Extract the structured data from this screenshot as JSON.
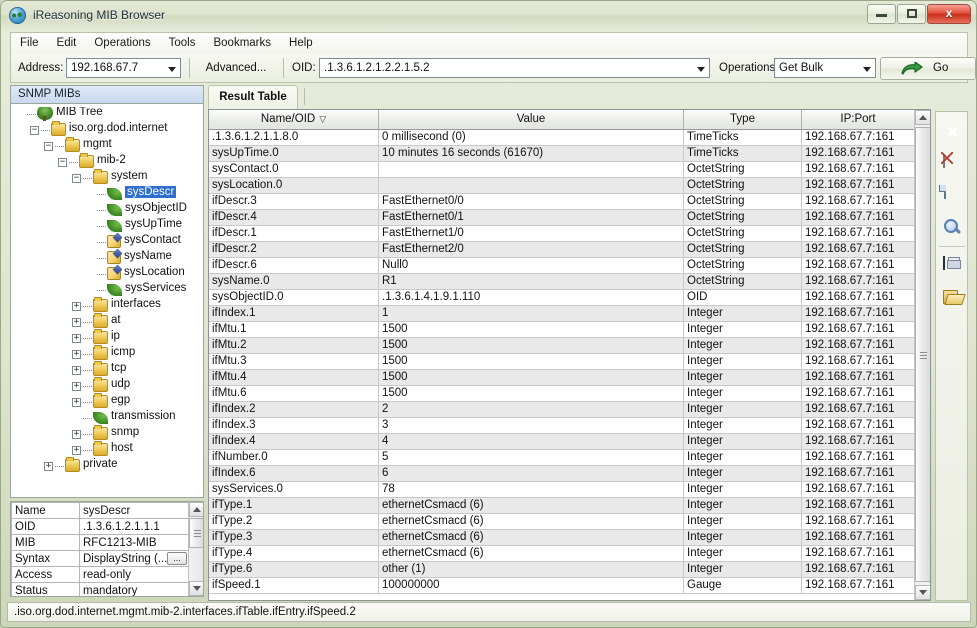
{
  "window": {
    "title": "iReasoning MIB Browser",
    "icon": "globe-icon",
    "minimize_label": "Minimize",
    "maximize_label": "Maximize",
    "close_label": "x"
  },
  "menubar": {
    "items": [
      {
        "label": "File"
      },
      {
        "label": "Edit"
      },
      {
        "label": "Operations"
      },
      {
        "label": "Tools"
      },
      {
        "label": "Bookmarks"
      },
      {
        "label": "Help"
      }
    ]
  },
  "toolbar": {
    "address_label": "Address:",
    "address_value": "192.168.67.7",
    "advanced_label": "Advanced...",
    "oid_label": "OID:",
    "oid_value": ".1.3.6.1.2.1.2.2.1.5.2",
    "operations_label": "Operations:",
    "operations_value": "Get Bulk",
    "go_label": "Go"
  },
  "left_panel": {
    "header": "SNMP MIBs",
    "tree": [
      {
        "label": "MIB Tree",
        "depth": 0,
        "icon": "tree-icon",
        "toggle": "none",
        "selected": false
      },
      {
        "label": "iso.org.dod.internet",
        "depth": 1,
        "icon": "folder-icon",
        "toggle": "expanded",
        "selected": false
      },
      {
        "label": "mgmt",
        "depth": 2,
        "icon": "folder-icon",
        "toggle": "expanded",
        "selected": false
      },
      {
        "label": "mib-2",
        "depth": 3,
        "icon": "folder-icon",
        "toggle": "expanded",
        "selected": false
      },
      {
        "label": "system",
        "depth": 4,
        "icon": "folder-icon",
        "toggle": "expanded",
        "selected": false
      },
      {
        "label": "sysDescr",
        "depth": 5,
        "icon": "leaf-icon",
        "toggle": "none",
        "selected": true
      },
      {
        "label": "sysObjectID",
        "depth": 5,
        "icon": "leaf-icon",
        "toggle": "none",
        "selected": false
      },
      {
        "label": "sysUpTime",
        "depth": 5,
        "icon": "leaf-icon",
        "toggle": "none",
        "selected": false
      },
      {
        "label": "sysContact",
        "depth": 5,
        "icon": "pencil-icon",
        "toggle": "none",
        "selected": false
      },
      {
        "label": "sysName",
        "depth": 5,
        "icon": "pencil-icon",
        "toggle": "none",
        "selected": false
      },
      {
        "label": "sysLocation",
        "depth": 5,
        "icon": "pencil-icon",
        "toggle": "none",
        "selected": false
      },
      {
        "label": "sysServices",
        "depth": 5,
        "icon": "leaf-icon",
        "toggle": "none",
        "selected": false
      },
      {
        "label": "interfaces",
        "depth": 4,
        "icon": "folder-icon",
        "toggle": "collapsed",
        "selected": false
      },
      {
        "label": "at",
        "depth": 4,
        "icon": "folder-icon",
        "toggle": "collapsed",
        "selected": false
      },
      {
        "label": "ip",
        "depth": 4,
        "icon": "folder-icon",
        "toggle": "collapsed",
        "selected": false
      },
      {
        "label": "icmp",
        "depth": 4,
        "icon": "folder-icon",
        "toggle": "collapsed",
        "selected": false
      },
      {
        "label": "tcp",
        "depth": 4,
        "icon": "folder-icon",
        "toggle": "collapsed",
        "selected": false
      },
      {
        "label": "udp",
        "depth": 4,
        "icon": "folder-icon",
        "toggle": "collapsed",
        "selected": false
      },
      {
        "label": "egp",
        "depth": 4,
        "icon": "folder-icon",
        "toggle": "collapsed",
        "selected": false
      },
      {
        "label": "transmission",
        "depth": 4,
        "icon": "leaf-icon",
        "toggle": "none",
        "selected": false
      },
      {
        "label": "snmp",
        "depth": 4,
        "icon": "folder-icon",
        "toggle": "collapsed",
        "selected": false
      },
      {
        "label": "host",
        "depth": 4,
        "icon": "folder-icon",
        "toggle": "collapsed",
        "selected": false
      },
      {
        "label": "private",
        "depth": 2,
        "icon": "folder-icon",
        "toggle": "collapsed",
        "selected": false
      }
    ]
  },
  "properties": {
    "rows": [
      {
        "key": "Name",
        "value": "sysDescr"
      },
      {
        "key": "OID",
        "value": ".1.3.6.1.2.1.1.1"
      },
      {
        "key": "MIB",
        "value": "RFC1213-MIB"
      },
      {
        "key": "Syntax",
        "value": "DisplayString (...",
        "has_ellipsis": true
      },
      {
        "key": "Access",
        "value": "read-only"
      },
      {
        "key": "Status",
        "value": "mandatory"
      }
    ]
  },
  "tabs": [
    {
      "label": "Result Table",
      "active": true
    }
  ],
  "result_table": {
    "columns": [
      {
        "label": "Name/OID",
        "sort": "descending",
        "sort_glyph": "▽"
      },
      {
        "label": "Value",
        "sort": "none",
        "sort_glyph": ""
      },
      {
        "label": "Type",
        "sort": "none",
        "sort_glyph": ""
      },
      {
        "label": "IP:Port",
        "sort": "none",
        "sort_glyph": ""
      }
    ],
    "rows": [
      {
        "name": ".1.3.6.1.2.1.1.8.0",
        "value": "0 millisecond (0)",
        "type": "TimeTicks",
        "ipport": "192.168.67.7:161"
      },
      {
        "name": "sysUpTime.0",
        "value": "10 minutes 16 seconds (61670)",
        "type": "TimeTicks",
        "ipport": "192.168.67.7:161"
      },
      {
        "name": "sysContact.0",
        "value": "",
        "type": "OctetString",
        "ipport": "192.168.67.7:161"
      },
      {
        "name": "sysLocation.0",
        "value": "",
        "type": "OctetString",
        "ipport": "192.168.67.7:161"
      },
      {
        "name": "ifDescr.3",
        "value": "FastEthernet0/0",
        "type": "OctetString",
        "ipport": "192.168.67.7:161"
      },
      {
        "name": "ifDescr.4",
        "value": "FastEthernet0/1",
        "type": "OctetString",
        "ipport": "192.168.67.7:161"
      },
      {
        "name": "ifDescr.1",
        "value": "FastEthernet1/0",
        "type": "OctetString",
        "ipport": "192.168.67.7:161"
      },
      {
        "name": "ifDescr.2",
        "value": "FastEthernet2/0",
        "type": "OctetString",
        "ipport": "192.168.67.7:161"
      },
      {
        "name": "ifDescr.6",
        "value": "Null0",
        "type": "OctetString",
        "ipport": "192.168.67.7:161"
      },
      {
        "name": "sysName.0",
        "value": "R1",
        "type": "OctetString",
        "ipport": "192.168.67.7:161"
      },
      {
        "name": "sysObjectID.0",
        "value": ".1.3.6.1.4.1.9.1.110",
        "type": "OID",
        "ipport": "192.168.67.7:161"
      },
      {
        "name": "ifIndex.1",
        "value": "1",
        "type": "Integer",
        "ipport": "192.168.67.7:161"
      },
      {
        "name": "ifMtu.1",
        "value": "1500",
        "type": "Integer",
        "ipport": "192.168.67.7:161"
      },
      {
        "name": "ifMtu.2",
        "value": "1500",
        "type": "Integer",
        "ipport": "192.168.67.7:161"
      },
      {
        "name": "ifMtu.3",
        "value": "1500",
        "type": "Integer",
        "ipport": "192.168.67.7:161"
      },
      {
        "name": "ifMtu.4",
        "value": "1500",
        "type": "Integer",
        "ipport": "192.168.67.7:161"
      },
      {
        "name": "ifMtu.6",
        "value": "1500",
        "type": "Integer",
        "ipport": "192.168.67.7:161"
      },
      {
        "name": "ifIndex.2",
        "value": "2",
        "type": "Integer",
        "ipport": "192.168.67.7:161"
      },
      {
        "name": "ifIndex.3",
        "value": "3",
        "type": "Integer",
        "ipport": "192.168.67.7:161"
      },
      {
        "name": "ifIndex.4",
        "value": "4",
        "type": "Integer",
        "ipport": "192.168.67.7:161"
      },
      {
        "name": "ifNumber.0",
        "value": "5",
        "type": "Integer",
        "ipport": "192.168.67.7:161"
      },
      {
        "name": "ifIndex.6",
        "value": "6",
        "type": "Integer",
        "ipport": "192.168.67.7:161"
      },
      {
        "name": "sysServices.0",
        "value": "78",
        "type": "Integer",
        "ipport": "192.168.67.7:161"
      },
      {
        "name": "ifType.1",
        "value": "ethernetCsmacd (6)",
        "type": "Integer",
        "ipport": "192.168.67.7:161"
      },
      {
        "name": "ifType.2",
        "value": "ethernetCsmacd (6)",
        "type": "Integer",
        "ipport": "192.168.67.7:161"
      },
      {
        "name": "ifType.3",
        "value": "ethernetCsmacd (6)",
        "type": "Integer",
        "ipport": "192.168.67.7:161"
      },
      {
        "name": "ifType.4",
        "value": "ethernetCsmacd (6)",
        "type": "Integer",
        "ipport": "192.168.67.7:161"
      },
      {
        "name": "ifType.6",
        "value": "other (1)",
        "type": "Integer",
        "ipport": "192.168.67.7:161"
      },
      {
        "name": "ifSpeed.1",
        "value": "100000000",
        "type": "Gauge",
        "ipport": "192.168.67.7:161"
      }
    ]
  },
  "side_tools": [
    {
      "icon": "delete-icon",
      "name": "delete-row-button"
    },
    {
      "icon": "clear-grid-icon",
      "name": "clear-table-button"
    },
    {
      "icon": "new-page-icon",
      "name": "new-document-button"
    },
    {
      "icon": "search-icon",
      "name": "find-button"
    },
    {
      "icon": "save-icon",
      "name": "save-results-button"
    },
    {
      "icon": "open-folder-icon",
      "name": "open-results-button"
    }
  ],
  "statusbar": {
    "text": ".iso.org.dod.internet.mgmt.mib-2.interfaces.ifTable.ifEntry.ifSpeed.2"
  }
}
